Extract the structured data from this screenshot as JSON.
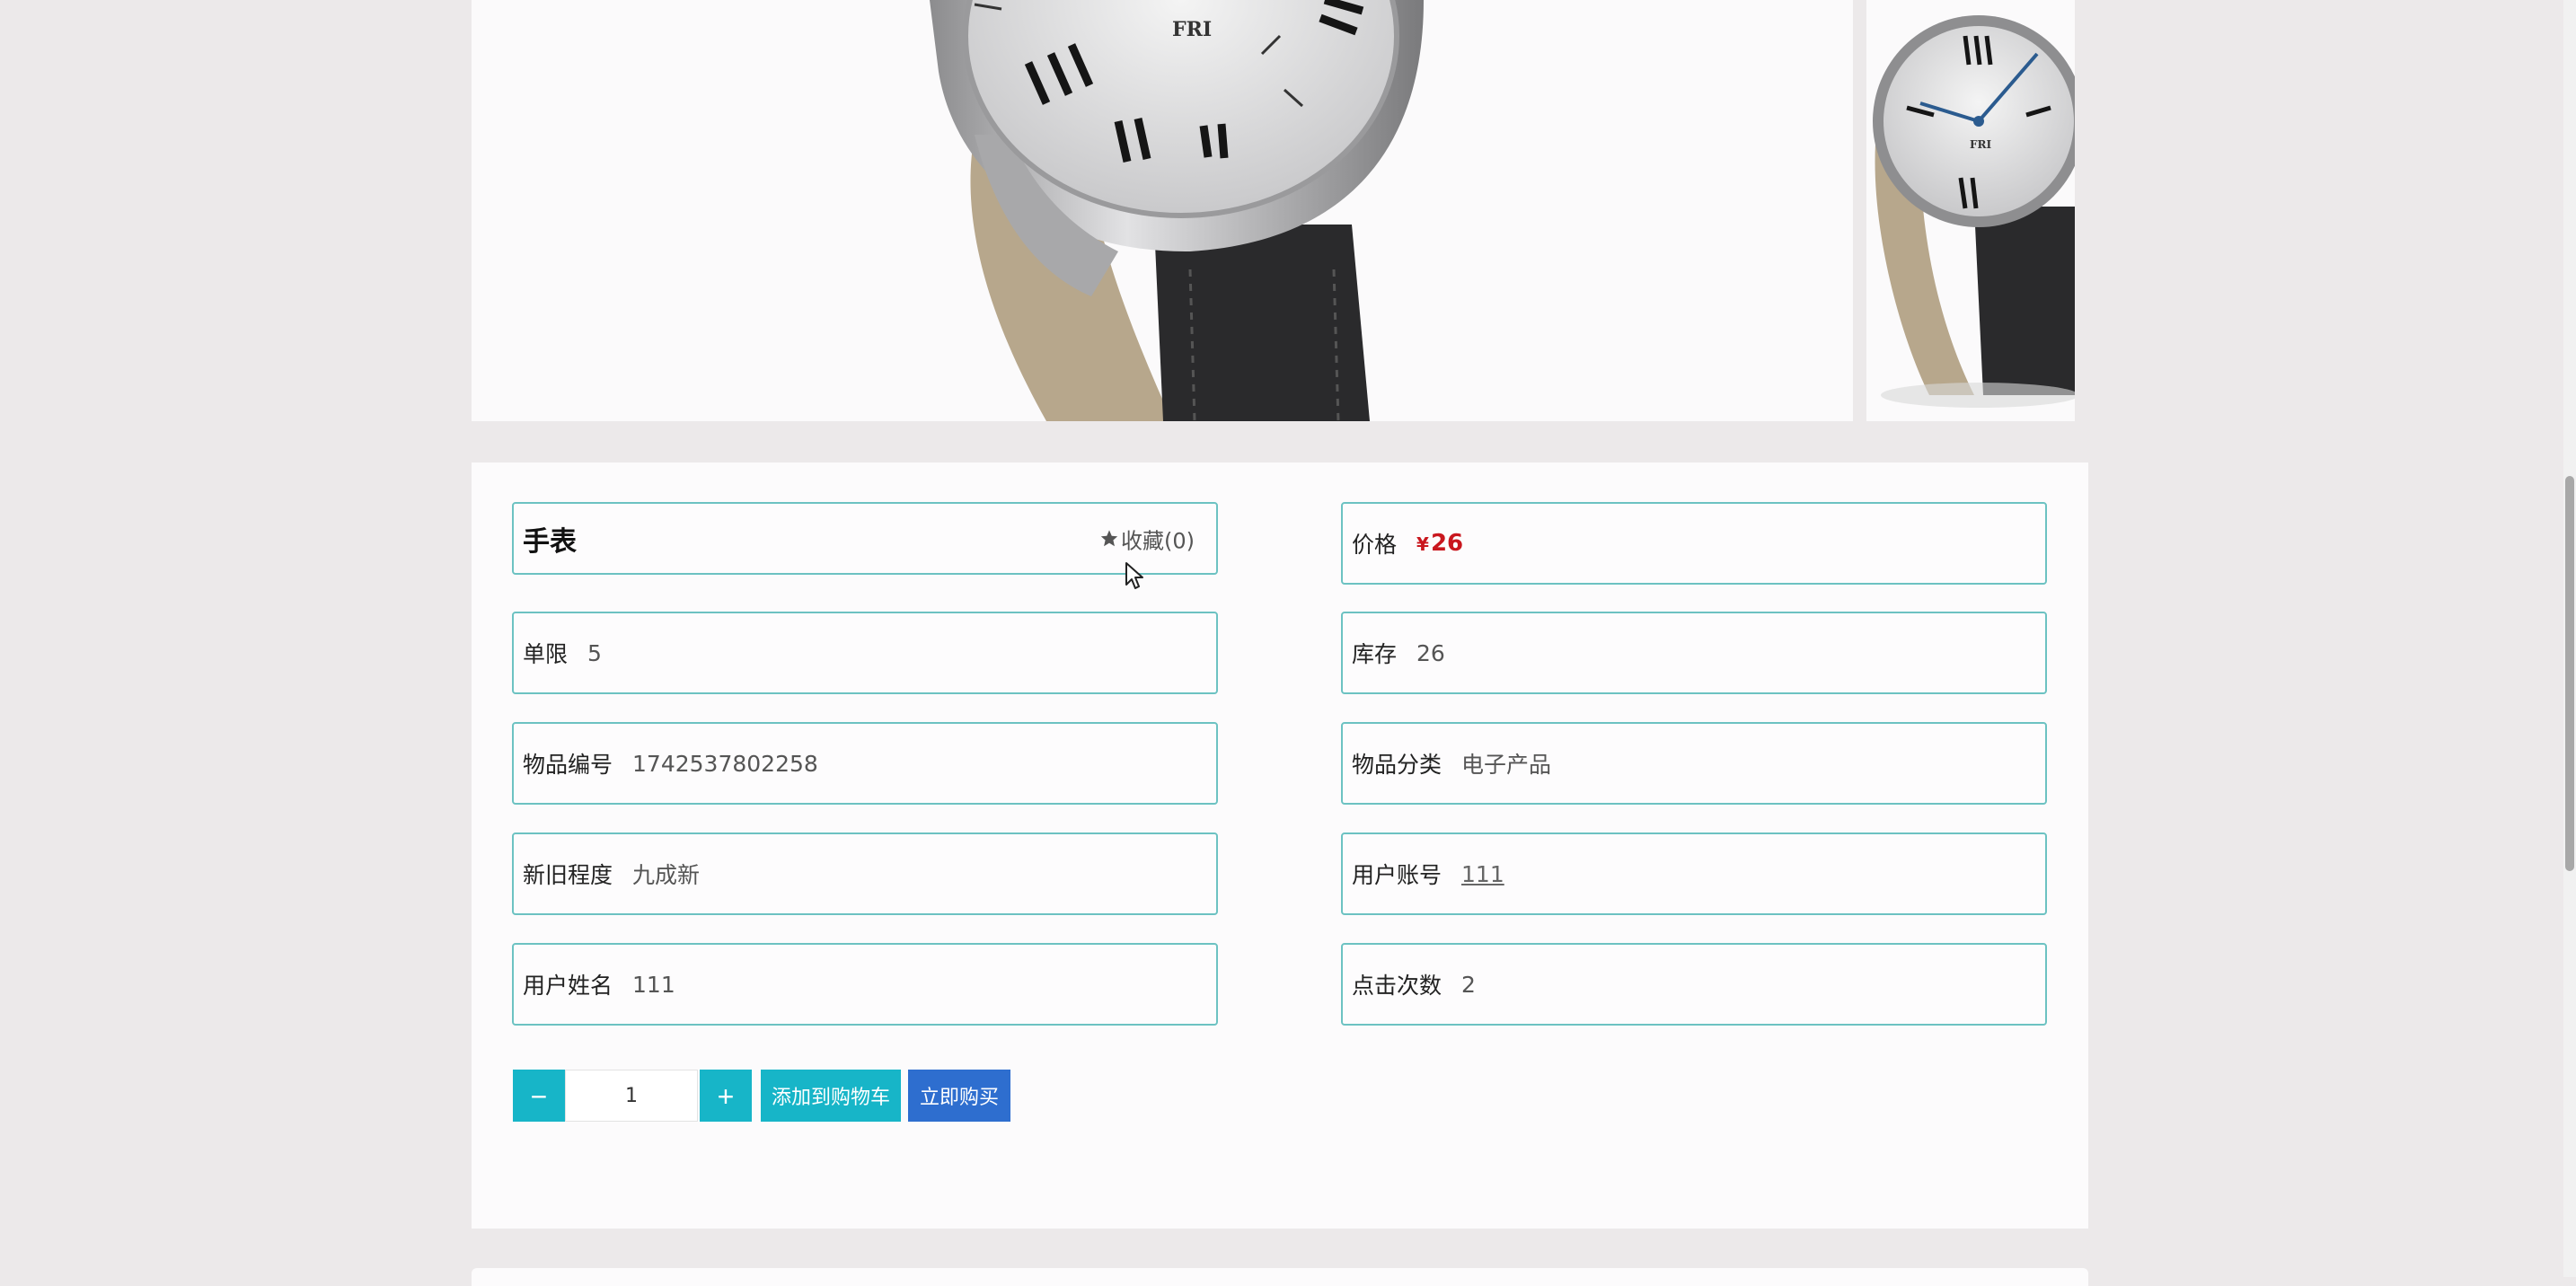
{
  "product": {
    "title": "手表",
    "favorite_label": "收藏(0)",
    "price": {
      "label": "价格",
      "currency": "¥",
      "value": "26"
    },
    "fields_left": [
      {
        "label": "单限",
        "value": "5"
      },
      {
        "label": "物品编号",
        "value": "1742537802258"
      },
      {
        "label": "新旧程度",
        "value": "九成新"
      },
      {
        "label": "用户姓名",
        "value": "111"
      }
    ],
    "fields_right": [
      {
        "label": "库存",
        "value": "26"
      },
      {
        "label": "物品分类",
        "value": "电子产品"
      },
      {
        "label": "用户账号",
        "value": "111"
      },
      {
        "label": "点击次数",
        "value": "2"
      }
    ]
  },
  "purchase": {
    "minus_symbol": "−",
    "plus_symbol": "+",
    "quantity": "1",
    "add_to_cart_label": "添加到购物车",
    "buy_now_label": "立即购买"
  },
  "gallery": {
    "watch_dial_text": "FRI"
  },
  "colors": {
    "accent_teal": "#17b5c8",
    "buy_blue": "#2e6ecf",
    "price_red": "#c9171e",
    "box_border": "#6cc2c2"
  },
  "icons": {
    "favorite": "star-icon",
    "cursor": "mouse-pointer-icon"
  }
}
